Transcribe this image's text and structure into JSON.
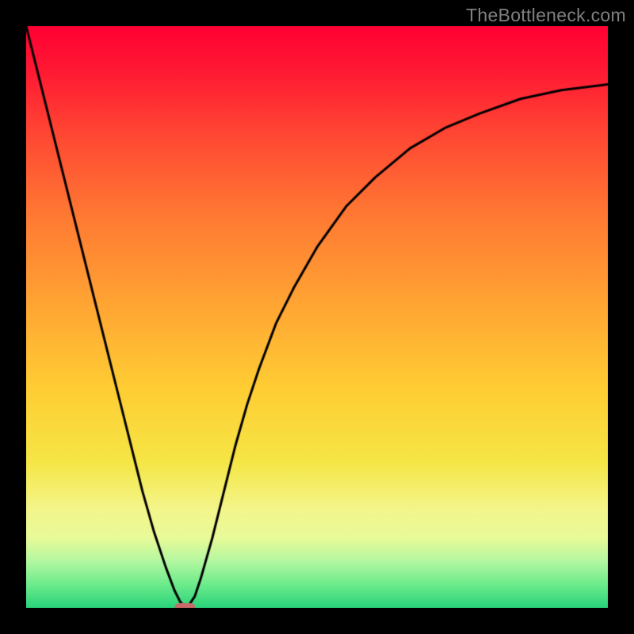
{
  "watermark": "TheBottleneck.com",
  "chart_data": {
    "type": "line",
    "title": "",
    "xlabel": "",
    "ylabel": "",
    "xlim": [
      0,
      100
    ],
    "ylim": [
      0,
      100
    ],
    "grid": false,
    "legend": false,
    "series": [
      {
        "name": "bottleneck-curve",
        "x": [
          0,
          2,
          4,
          6,
          8,
          10,
          12,
          14,
          16,
          18,
          20,
          22,
          24,
          25.5,
          26.5,
          27.5,
          28,
          29,
          30,
          32,
          34,
          36,
          38,
          40,
          43,
          46,
          50,
          55,
          60,
          66,
          72,
          78,
          85,
          92,
          100
        ],
        "values": [
          100,
          92,
          84,
          76,
          68,
          60,
          52,
          44,
          36,
          28,
          20,
          13,
          7,
          3,
          1,
          0,
          0.5,
          2,
          5,
          12,
          20,
          28,
          35,
          41,
          49,
          55,
          62,
          69,
          74,
          79,
          82.5,
          85,
          87.5,
          89,
          90
        ]
      }
    ],
    "marker": {
      "name": "optimal-point",
      "x": 27.3,
      "y": 0.0,
      "color": "#c76a6a",
      "shape": "rounded-rect"
    },
    "gradient_stops_percent_to_color": {
      "0": "#ff0033",
      "18": "#ff4433",
      "48": "#ffa533",
      "75": "#f5e645",
      "92": "#b2f7a0",
      "100": "#29d37a"
    }
  }
}
